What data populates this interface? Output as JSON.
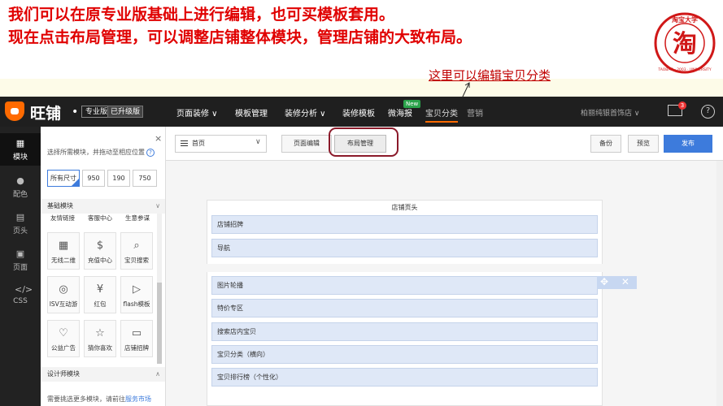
{
  "caption": {
    "line1": "我们可以在原专业版基础上进行编辑，也可买模板套用。",
    "line2": "现在点击布局管理，可以调整店铺整体模块，管理店铺的大致布局。",
    "annotation": "这里可以编辑宝贝分类"
  },
  "seal": {
    "top": "淘宝大学",
    "center": "淘",
    "bottom": "TAOBAO · 2003 · UNIVERSITY"
  },
  "topnav": {
    "logo": "旺铺",
    "badge_pro": "专业版",
    "badge_upgrade": "已升级版",
    "items": [
      {
        "label": "页面装修 ∨"
      },
      {
        "label": "模板管理"
      },
      {
        "label": "装修分析 ∨"
      },
      {
        "label": "装修模板"
      },
      {
        "label": "微海报"
      },
      {
        "label": "宝贝分类"
      },
      {
        "label": "营销"
      }
    ],
    "new_badge": "New",
    "shop_name": "柏丽纯银首饰店 ∨",
    "mail_count": "3",
    "help": "?"
  },
  "rail": {
    "items": [
      {
        "label": "模块",
        "icon": "grid-icon"
      },
      {
        "label": "配色",
        "icon": "palette-icon"
      },
      {
        "label": "页头",
        "icon": "header-icon"
      },
      {
        "label": "页面",
        "icon": "page-icon"
      },
      {
        "label": "CSS",
        "icon": "code-icon"
      }
    ]
  },
  "panel": {
    "close": "×",
    "hint": "选择所需模块，并拖动至相应位置",
    "sizes": [
      "所有尺寸",
      "950",
      "190",
      "750"
    ],
    "basic_header": "基础模块",
    "partial_row": [
      "友情链接",
      "客服中心",
      "生意参谋"
    ],
    "modules": [
      {
        "label": "无线二维",
        "icon": "qr-icon",
        "glyph": "▦"
      },
      {
        "label": "充值中心",
        "icon": "coin-icon",
        "glyph": "$"
      },
      {
        "label": "宝贝搜索",
        "icon": "search-icon",
        "glyph": "⌕"
      },
      {
        "label": "ISV互动游",
        "icon": "gamepad-icon",
        "glyph": "◎"
      },
      {
        "label": "红包",
        "icon": "red-packet-icon",
        "glyph": "¥"
      },
      {
        "label": "flash模板",
        "icon": "play-icon",
        "glyph": "▷"
      },
      {
        "label": "公益广告",
        "icon": "heart-icon",
        "glyph": "♡"
      },
      {
        "label": "猜你喜欢",
        "icon": "star-icon",
        "glyph": "☆"
      },
      {
        "label": "店铺招牌",
        "icon": "banner-icon",
        "glyph": "▭"
      }
    ],
    "designer_header": "设计师模块",
    "more_text": "需要挑选更多模块，请前往",
    "more_link": "服务市场"
  },
  "toolbar": {
    "page_select": "首页",
    "page_edit": "页面编辑",
    "layout_manage": "布局管理",
    "backup": "备份",
    "preview": "预览",
    "publish": "发布"
  },
  "canvas": {
    "header_group_title": "店铺页头",
    "header_modules": [
      "店铺招牌",
      "导航"
    ],
    "body_modules": [
      "图片轮播",
      "特价专区",
      "搜索店内宝贝",
      "宝贝分类（横向）",
      "宝贝排行榜（个性化）"
    ],
    "hover_controls": "✥ ✕"
  },
  "colors": {
    "accent": "#3d7bdc",
    "caption": "#e00000",
    "annotation": "#c00000",
    "brand": "#ff6a00",
    "highlight_ring": "#8b1a2a"
  }
}
